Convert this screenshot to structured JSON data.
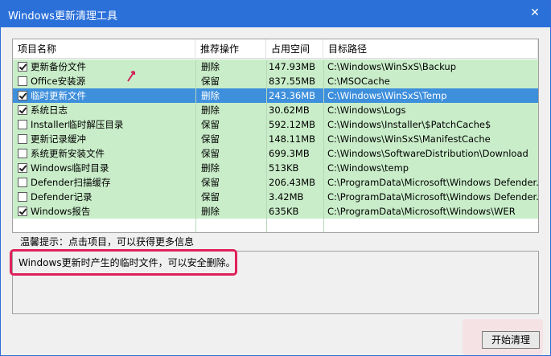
{
  "window": {
    "title": "Windows更新清理工具",
    "close_label": "✕"
  },
  "list": {
    "headers": [
      "项目名称",
      "推荐操作",
      "占用空间",
      "目标路径"
    ],
    "rows": [
      {
        "checked": true,
        "name": "更新备份文件",
        "action": "删除",
        "size": "147.93MB",
        "path": "C:\\Windows\\WinSxS\\Backup",
        "selected": false
      },
      {
        "checked": false,
        "name": "Office安装源",
        "action": "保留",
        "size": "837.55MB",
        "path": "C:\\MSOCache",
        "selected": false
      },
      {
        "checked": true,
        "name": "临时更新文件",
        "action": "删除",
        "size": "243.36MB",
        "path": "C:\\Windows\\WinSxS\\Temp",
        "selected": true
      },
      {
        "checked": true,
        "name": "系统日志",
        "action": "删除",
        "size": "30.62MB",
        "path": "C:\\Windows\\Logs",
        "selected": false
      },
      {
        "checked": false,
        "name": "Installer临时解压目录",
        "action": "保留",
        "size": "592.12MB",
        "path": "C:\\Windows\\Installer\\$PatchCache$",
        "selected": false
      },
      {
        "checked": false,
        "name": "更新记录缓冲",
        "action": "保留",
        "size": "148.11MB",
        "path": "C:\\Windows\\WinSxS\\ManifestCache",
        "selected": false
      },
      {
        "checked": false,
        "name": "系统更新安装文件",
        "action": "保留",
        "size": "699.3MB",
        "path": "C:\\Windows\\SoftwareDistribution\\Download",
        "selected": false
      },
      {
        "checked": true,
        "name": "Windows临时目录",
        "action": "删除",
        "size": "513KB",
        "path": "C:\\Windows\\temp",
        "selected": false
      },
      {
        "checked": false,
        "name": "Defender扫描缓存",
        "action": "保留",
        "size": "206.43MB",
        "path": "C:\\ProgramData\\Microsoft\\Windows Defender...",
        "selected": false
      },
      {
        "checked": false,
        "name": "Defender记录",
        "action": "保留",
        "size": "3.42MB",
        "path": "C:\\ProgramData\\Microsoft\\Windows Defender...",
        "selected": false
      },
      {
        "checked": true,
        "name": "Windows报告",
        "action": "删除",
        "size": "635KB",
        "path": "C:\\ProgramData\\Microsoft\\Windows\\WER",
        "selected": false
      }
    ]
  },
  "hint": "温馨提示：点击项目，可以获得更多信息",
  "description": "Windows更新时产生的临时文件，可以安全删除。",
  "start_button": "开始清理",
  "colors": {
    "titlebar": "#2b70d9",
    "row_bg": "#c9edc9",
    "selected_bg": "#3e8fdc",
    "highlight": "#e0215a"
  }
}
